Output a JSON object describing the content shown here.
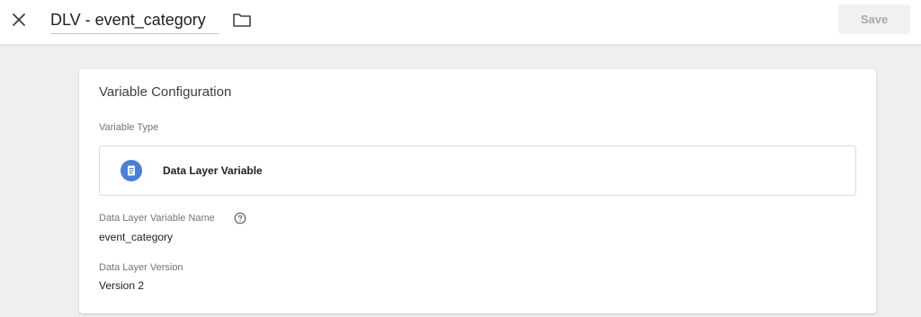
{
  "header": {
    "close_icon": "close-icon",
    "title": "DLV - event_category",
    "folder_icon": "folder-icon",
    "save_label": "Save"
  },
  "card": {
    "title": "Variable Configuration",
    "variable_type_label": "Variable Type",
    "variable_type": {
      "icon": "data-layer-icon",
      "icon_color": "#4a7fd8",
      "name": "Data Layer Variable"
    },
    "fields": [
      {
        "label": "Data Layer Variable Name",
        "value": "event_category",
        "help_icon": "help-circle-icon"
      },
      {
        "label": "Data Layer Version",
        "value": "Version 2"
      }
    ]
  }
}
